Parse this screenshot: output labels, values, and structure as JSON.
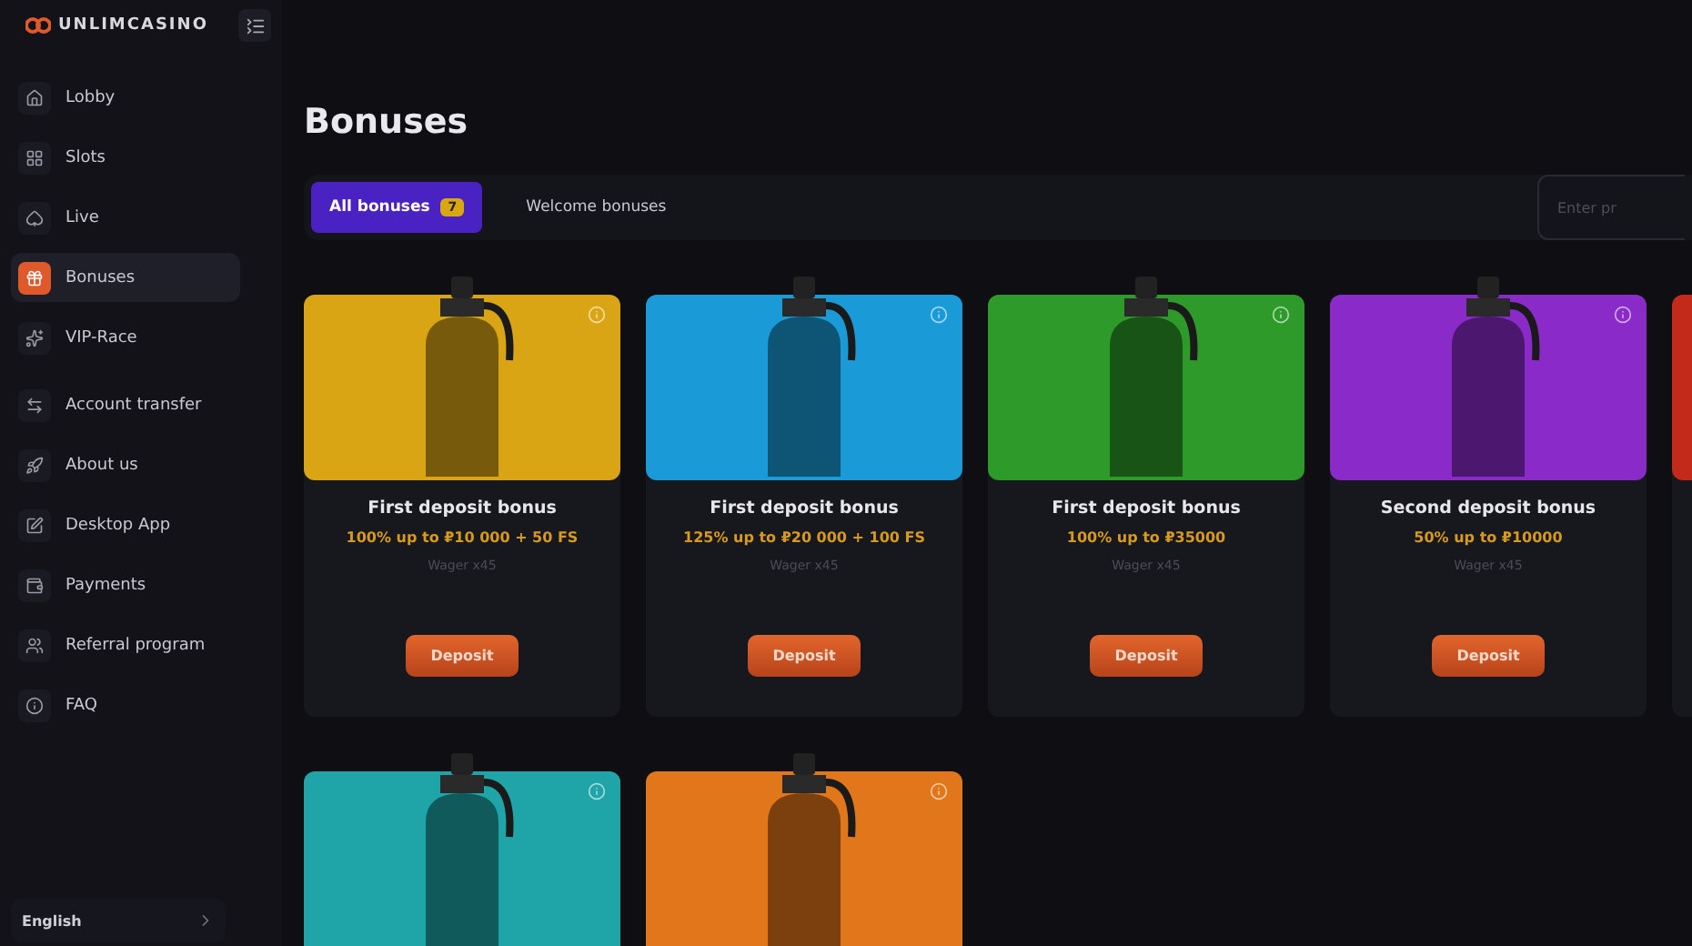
{
  "brand": {
    "name": "UNLIMCASINO"
  },
  "sidebar": {
    "items": [
      {
        "label": "Lobby",
        "selected": false
      },
      {
        "label": "Slots",
        "selected": false
      },
      {
        "label": "Live",
        "selected": false
      },
      {
        "label": "Bonuses",
        "selected": true
      },
      {
        "label": "VIP-Race",
        "selected": false
      },
      {
        "label": "Account transfer",
        "selected": false
      },
      {
        "label": "About us",
        "selected": false
      },
      {
        "label": "Desktop App",
        "selected": false
      },
      {
        "label": "Payments",
        "selected": false
      },
      {
        "label": "Referral program",
        "selected": false
      },
      {
        "label": "FAQ",
        "selected": false
      }
    ],
    "language": "English"
  },
  "page_title": "Bonuses",
  "tabs": [
    {
      "label": "All bonuses",
      "count": "7",
      "selected": true
    },
    {
      "label": "Welcome bonuses",
      "selected": false
    }
  ],
  "search": {
    "placeholder": "Enter pr"
  },
  "cards": [
    {
      "color": "#d9a514",
      "title": "First deposit bonus",
      "offer": "100% up to ₽10 000 + 50 FS",
      "wager": "Wager x45",
      "button": "Deposit"
    },
    {
      "color": "#1a9ad6",
      "title": "First deposit bonus",
      "offer": "125% up to ₽20 000 + 100 FS",
      "wager": "Wager x45",
      "button": "Deposit"
    },
    {
      "color": "#2e9a2a",
      "title": "First deposit bonus",
      "offer": "100% up to ₽35000",
      "wager": "Wager x45",
      "button": "Deposit"
    },
    {
      "color": "#8a2bc9",
      "title": "Second deposit bonus",
      "offer": "50% up to ₽10000",
      "wager": "Wager x45",
      "button": "Deposit"
    },
    {
      "color": "#c42a1a"
    },
    {
      "color": "#1fa5a8"
    },
    {
      "color": "#e2761a"
    }
  ]
}
